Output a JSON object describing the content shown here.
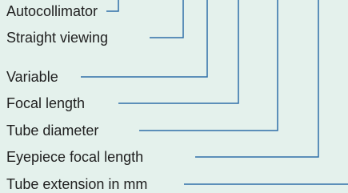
{
  "diagram": {
    "line_color": "#2f6fa8",
    "background_color": "#e4f1ec",
    "labels": [
      "Autocollimator",
      "Straight viewing",
      "Variable",
      "Focal length",
      "Tube diameter",
      "Eyepiece focal length",
      "Tube extension in mm"
    ]
  }
}
